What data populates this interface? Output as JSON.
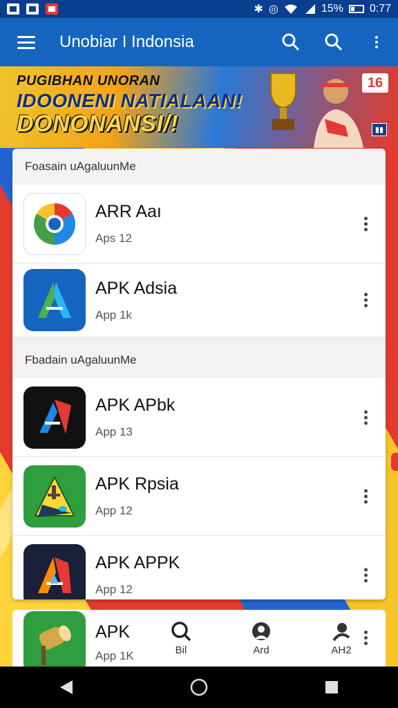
{
  "status_bar": {
    "battery": "15%",
    "time": "0:77"
  },
  "app_bar": {
    "title": "Unobiar I Indonsia"
  },
  "banner": {
    "line1": "PUGIBHAN UNORAN",
    "line2": "IDOONENI NATIALAAN!",
    "line3": "DONONANSI/!",
    "badge": "16"
  },
  "sections": [
    {
      "header": "Foasain uAgaluunMe",
      "apps": [
        {
          "name": "ARR Aaı",
          "meta": "Aps 12",
          "icon": "chrome-like-icon"
        },
        {
          "name": "APK Adsia",
          "meta": "App 1k",
          "icon": "blue-a-icon"
        }
      ]
    },
    {
      "header": "Fbadain uAgaluunMe",
      "apps": [
        {
          "name": "APK APbk",
          "meta": "App 13",
          "icon": "dark-a-icon"
        },
        {
          "name": "APK Rpsia",
          "meta": "App 12",
          "icon": "green-a-icon"
        },
        {
          "name": "APK APPK",
          "meta": "App 12",
          "icon": "flame-a-icon"
        }
      ]
    }
  ],
  "partial_app": {
    "name": "APK",
    "meta": "App 1K",
    "icon": "gold-cylinder-icon"
  },
  "bottom_tabs": [
    {
      "label": "Bil",
      "icon": "search-icon"
    },
    {
      "label": "Ard",
      "icon": "person-icon"
    },
    {
      "label": "AH2",
      "icon": "user-icon"
    }
  ],
  "colors": {
    "app_bar": "#1565c0",
    "status_bar": "#0a3e8f"
  }
}
